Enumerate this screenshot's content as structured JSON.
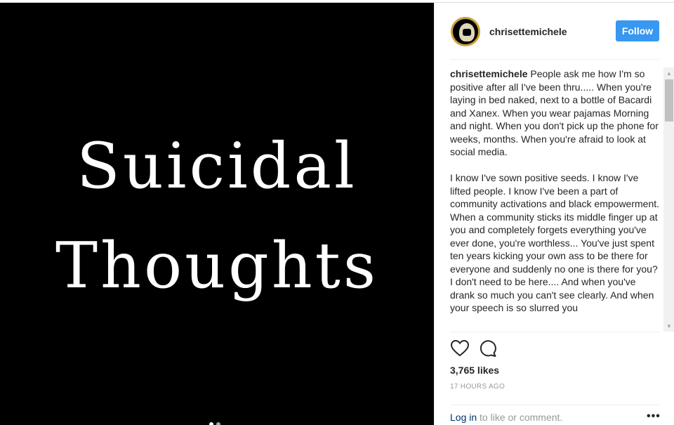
{
  "post": {
    "media_text_line1": "Suicidal",
    "media_text_line2": "Thoughts"
  },
  "header": {
    "username": "chrisettemichele",
    "follow_label": "Follow"
  },
  "caption": {
    "username": "chrisettemichele",
    "paragraph1": "People ask me how I'm so positive after all I've been thru..... When you're laying in bed naked, next to a bottle of Bacardi and Xanex. When you wear pajamas Morning and night. When you don't pick up the phone for weeks, months. When you're afraid to look at social media.",
    "paragraph2": "I know I've sown positive seeds. I know I've lifted people. I know I've been a part of community activations and black empowerment. When a community sticks its middle finger up at you and completely forgets everything you've ever done, you're worthless... You've just spent ten years kicking your own ass to be there for everyone and suddenly no one is there for you? I don't need to be here.... And when you've drank so much you can't see clearly. And when your speech is so slurred you"
  },
  "stats": {
    "likes": "3,765 likes",
    "time": "17 HOURS AGO"
  },
  "footer": {
    "login_label": "Log in",
    "login_suffix": " to like or comment.",
    "more_label": "•••"
  },
  "icons": {
    "like": "heart-icon",
    "comment": "comment-icon"
  },
  "colors": {
    "follow_button": "#3897f0",
    "link": "#003569",
    "avatar_ring": "#c8a23a"
  }
}
